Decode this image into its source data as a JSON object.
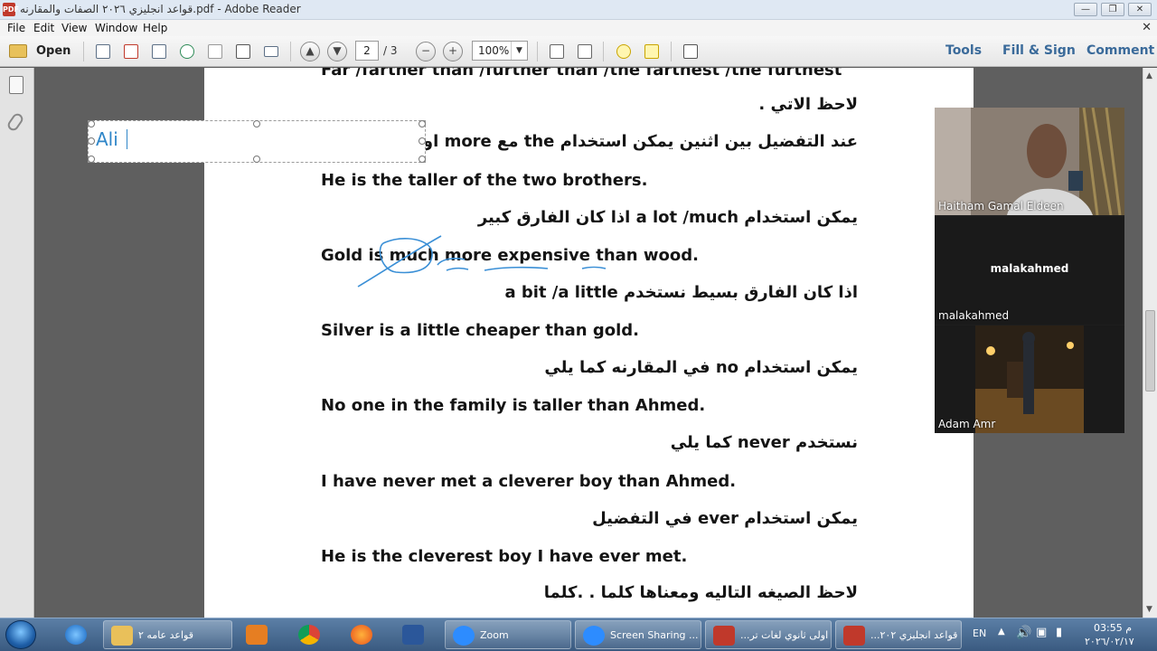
{
  "window": {
    "title": "قواعد انجليزي ٢٠٢٦ الصفات والمقارنه.pdf - Adobe Reader",
    "app_icon": "pdf-icon",
    "controls": [
      "minimize",
      "restore",
      "close"
    ]
  },
  "menu": {
    "file": "File",
    "edit": "Edit",
    "view": "View",
    "window": "Window",
    "help": "Help",
    "close_glyph": "✕"
  },
  "toolbar": {
    "open_label": "Open",
    "page_current": "2",
    "page_total": "/ 3",
    "zoom": "100%",
    "tools": "Tools",
    "fill_sign": "Fill & Sign",
    "comment": "Comment"
  },
  "document": {
    "lines": [
      "Far /farther than /further than /the farthest /the furthest",
      "لاحظ الاتي .",
      "عند التفضيل بين اثنين يمكن استخدام the مع more او er",
      "He is the taller of the two brothers.",
      "يمكن استخدام a lot /much اذا كان الفارق كبير",
      "Gold is much more expensive than wood.",
      "اذا كان الفارق بسيط نستخدم a bit /a little",
      "Silver is a little cheaper than gold.",
      "يمكن استخدام no في المقارنه كما يلي",
      "No one in the family is taller than Ahmed.",
      "نستخدم never كما يلي",
      "I have never met a cleverer boy than Ahmed.",
      "يمكن استخدام ever في التفضيل",
      "He is the cleverest boy I have ever met.",
      "لاحظ الصيغه التاليه ومعناها كلما . .كلما"
    ],
    "annotation_text": "Ali",
    "ink_color": "#3a8fd6"
  },
  "zoom_participants": [
    {
      "name": "Haitham Gamal Eldeen",
      "video": true
    },
    {
      "name": "malakahmed",
      "video": false
    },
    {
      "name": "Adam Amr",
      "video": true
    }
  ],
  "taskbar": {
    "items": [
      {
        "icon": "folder-icon",
        "label": "قواعد عامه ٢"
      },
      {
        "icon": "zoom-icon",
        "label": "Zoom"
      },
      {
        "icon": "zoom-icon",
        "label": "Screen Sharing ..."
      },
      {
        "icon": "pdf-icon",
        "label": "اولى ثانوي لغات تر..."
      },
      {
        "icon": "pdf-icon",
        "label": "قواعد انجليزي ٢٠٢..."
      }
    ],
    "language": "EN",
    "time": "03:55 م",
    "date": "٢٠٢٦/٠٢/١٧"
  },
  "colors": {
    "titlebar": "#dfe8f3",
    "link": "#3a6a9a",
    "annotation": "#2f86c8",
    "taskbar": "#3a5a80"
  }
}
